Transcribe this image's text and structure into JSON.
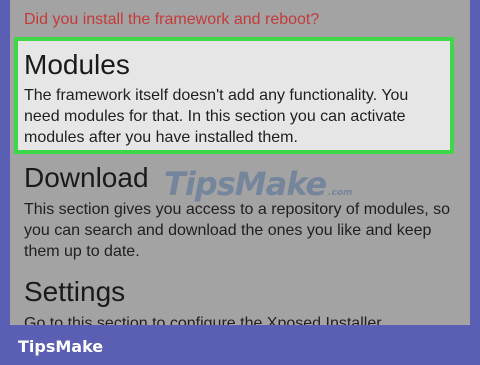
{
  "warning_text": "Did you install the framework and reboot?",
  "sections": [
    {
      "title": "Modules",
      "description": "The framework itself doesn't add any functionality. You need modules for that. In this section you can activate modules after you have installed them."
    },
    {
      "title": "Download",
      "description": "This section gives you access to a repository of modules, so you can search and download the ones you like and keep them up to date."
    },
    {
      "title": "Settings",
      "description": "Go to this section to configure the Xposed Installer"
    }
  ],
  "watermark": {
    "text": "TipsMake",
    "suffix": ".com"
  },
  "footer_brand": "TipsMake",
  "colors": {
    "highlight": "#40d64a",
    "warning": "#c43a3a",
    "frame": "#5b5fb3"
  }
}
